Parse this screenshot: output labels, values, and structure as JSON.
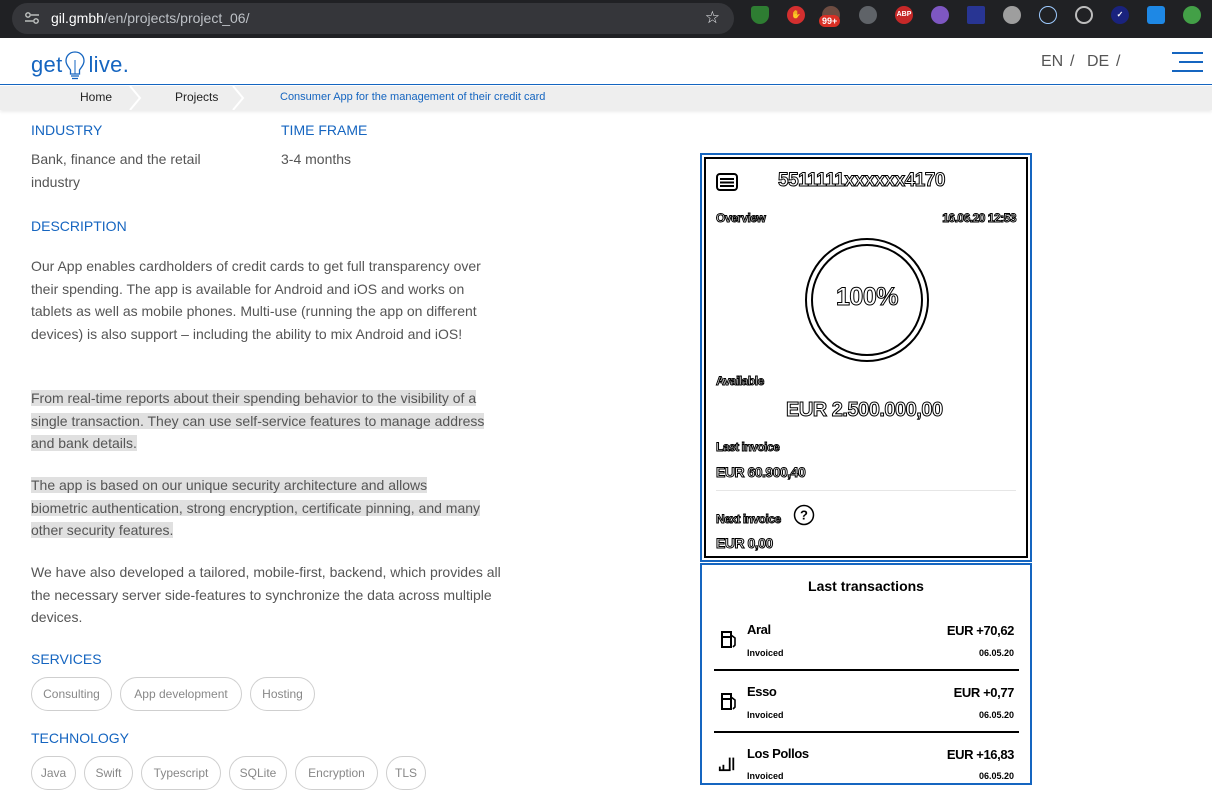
{
  "browser": {
    "url_host": "gil.gmbh",
    "url_path": "/en/projects/project_06/",
    "ext_badge": "99+",
    "ext_abp": "ABP"
  },
  "header": {
    "logo_left": "get",
    "logo_right": "live.",
    "lang_en": "EN",
    "lang_de": "DE",
    "lang_sep": "/"
  },
  "breadcrumb": {
    "home": "Home",
    "projects": "Projects",
    "current": "Consumer App for the management of their credit card"
  },
  "content": {
    "industry_label": "INDUSTRY",
    "industry_value": "Bank, finance and the retail industry",
    "timeframe_label": "TIME FRAME",
    "timeframe_value": "3-4 months",
    "description_label": "DESCRIPTION",
    "para1": "Our App enables cardholders of credit cards to get full transparency over their spending. The app is available for Android and iOS and works on tablets as well as mobile phones. Multi-use (running the app on different devices) is also support – including the ability to mix Android and iOS!",
    "para2": "From real-time reports about their spending behavior to the visibility of a single transaction. They can use self-service features to manage address and bank details.",
    "para3": "The app is based on our unique security architecture and allows biometric authentication, strong encryption, certificate pinning, and many other security features.",
    "para4": "We have also developed a tailored, mobile-first, backend, which provides all the necessary server side-features to synchronize the data across multiple devices.",
    "services_label": "SERVICES",
    "services": [
      "Consulting",
      "App development",
      "Hosting"
    ],
    "technology_label": "TECHNOLOGY",
    "technology": [
      "Java",
      "Swift",
      "Typescript",
      "SQLite",
      "Encryption",
      "TLS"
    ]
  },
  "phone": {
    "card_number": "5511111xxxxxx4170",
    "overview_label": "Overview",
    "overview_date": "16.06.20 12:53",
    "percent": "100%",
    "available_label": "Available",
    "available_amount": "EUR 2.500.000,00",
    "last_invoice_label": "Last invoice",
    "last_invoice_amount": "EUR 60.900,40",
    "next_invoice_label": "Next invoice",
    "next_invoice_amount": "EUR 0,00",
    "transactions_title": "Last transactions",
    "transactions": [
      {
        "name": "Aral",
        "status": "Invoiced",
        "amount": "EUR +70,62",
        "date": "06.05.20",
        "icon": "fuel-icon"
      },
      {
        "name": "Esso",
        "status": "Invoiced",
        "amount": "EUR +0,77",
        "date": "06.05.20",
        "icon": "fuel-icon"
      },
      {
        "name": "Los Pollos",
        "status": "Invoiced",
        "amount": "EUR +16,83",
        "date": "06.05.20",
        "icon": "restaurant-icon"
      }
    ]
  }
}
